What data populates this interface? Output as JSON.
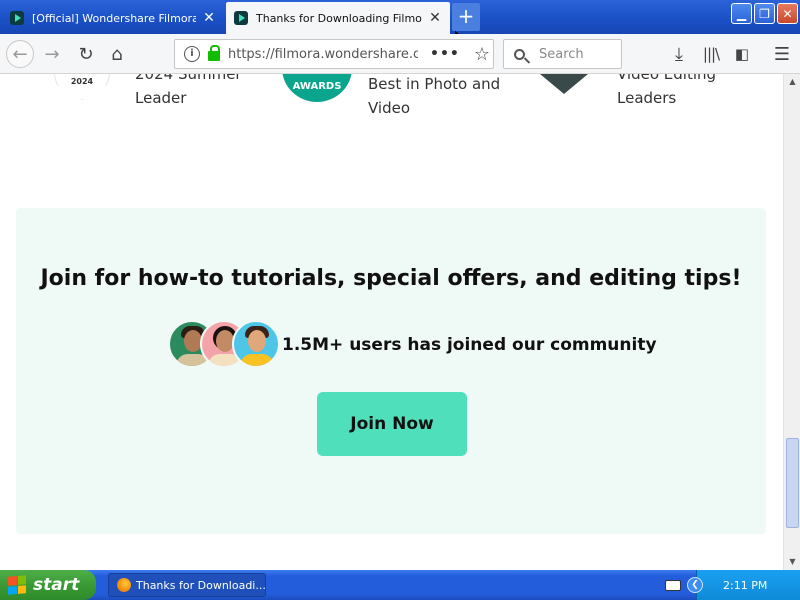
{
  "browser": {
    "tabs": [
      {
        "title": "[Official] Wondershare Filmora – Å",
        "active": false
      },
      {
        "title": "Thanks for Downloading Filmora",
        "active": true
      }
    ],
    "new_tab_label": "+",
    "url": "https://filmora.wondershare.co",
    "search_placeholder": "Search"
  },
  "awards": [
    {
      "text_line1": "2024 Summer",
      "text_line2": "Leader",
      "badge_year": "2024"
    },
    {
      "text_line1": "Best in Photo and",
      "text_line2": "Video",
      "badge_label": "AWARDS"
    },
    {
      "text_line1": "Video Editing",
      "text_line2": "Leaders"
    }
  ],
  "promo": {
    "heading": "Join for how-to tutorials, special offers, and editing tips!",
    "community_text": "1.5M+ users has joined our community",
    "join_button": "Join Now"
  },
  "scrollbar": {
    "position_fraction": 0.93
  },
  "taskbar": {
    "start_label": "start",
    "task_item": "Thanks for Downloadi...",
    "clock": "2:11 PM"
  },
  "colors": {
    "promo_background": "#effaf7",
    "join_button": "#4fe0bb",
    "titlebar": "#1a4fc4",
    "start_green": "#3a9a35"
  }
}
